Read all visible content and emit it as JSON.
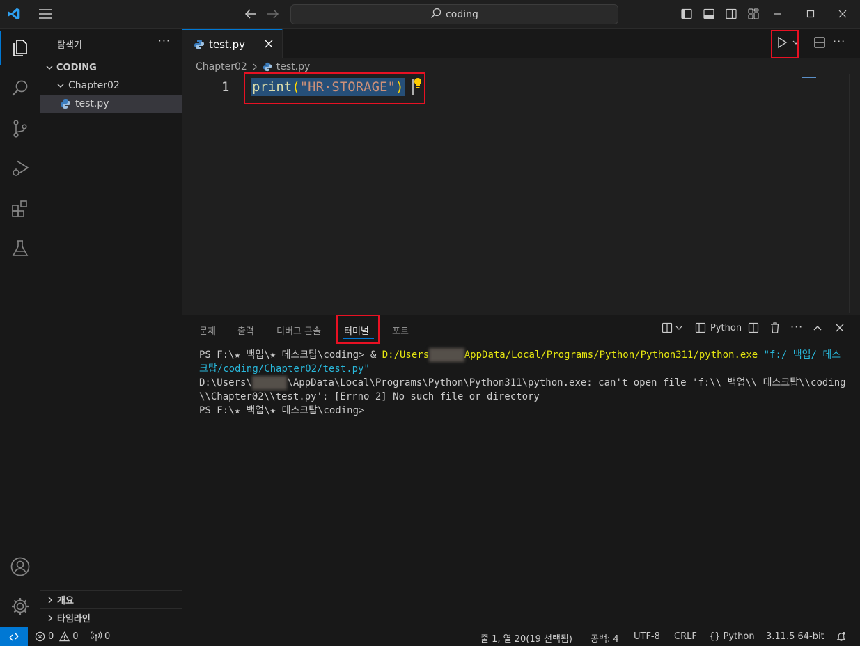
{
  "titlebar": {
    "search_text": "coding"
  },
  "sidebar": {
    "title": "탐색기",
    "more": "···",
    "root_folder": "CODING",
    "folder": "Chapter02",
    "file": "test.py",
    "sections": [
      "개요",
      "타임라인"
    ]
  },
  "editor": {
    "tab_label": "test.py",
    "breadcrumb_folder": "Chapter02",
    "breadcrumb_file": "test.py",
    "line_number": "1",
    "code_fn": "print",
    "code_open": "(",
    "code_str": "\"HR·STORAGE\"",
    "code_close": ")"
  },
  "panel": {
    "tabs": [
      "문제",
      "출력",
      "디버그 콘솔",
      "터미널",
      "포트"
    ],
    "active_tab": "터미널",
    "shell_label": "Python",
    "terminal": {
      "l1_prompt": "PS F:\\★ 백업\\★ 데스크탑\\coding> & ",
      "l1_exe_a": "D:/Users",
      "l1_exe_b": "AppData/Local/Programs/Python/Python311/python.exe",
      "l1_arg": " \"f:/ 백업/ 데스크탑/coding/Chapter02/test.py\"",
      "l2_a": "D:\\Users\\",
      "l2_b": "\\AppData\\Local\\Programs\\Python\\Python311\\python.exe: can't open file 'f:\\\\ 백업\\\\ 데스크탑\\\\coding\\\\Chapter02\\\\test.py': [Errno 2] No such file or directory",
      "l3": "PS F:\\★ 백업\\★ 데스크탑\\coding>"
    }
  },
  "statusbar": {
    "errors": "0",
    "warnings": "0",
    "ports": "0",
    "position": "줄 1, 열 20(19 선택됨)",
    "spaces": "공백: 4",
    "encoding": "UTF-8",
    "eol": "CRLF",
    "language": "Python",
    "interpreter": "3.11.5 64-bit"
  },
  "colors": {
    "accent": "#0078d4",
    "highlight_box": "#e81123",
    "selection": "#264f78"
  }
}
